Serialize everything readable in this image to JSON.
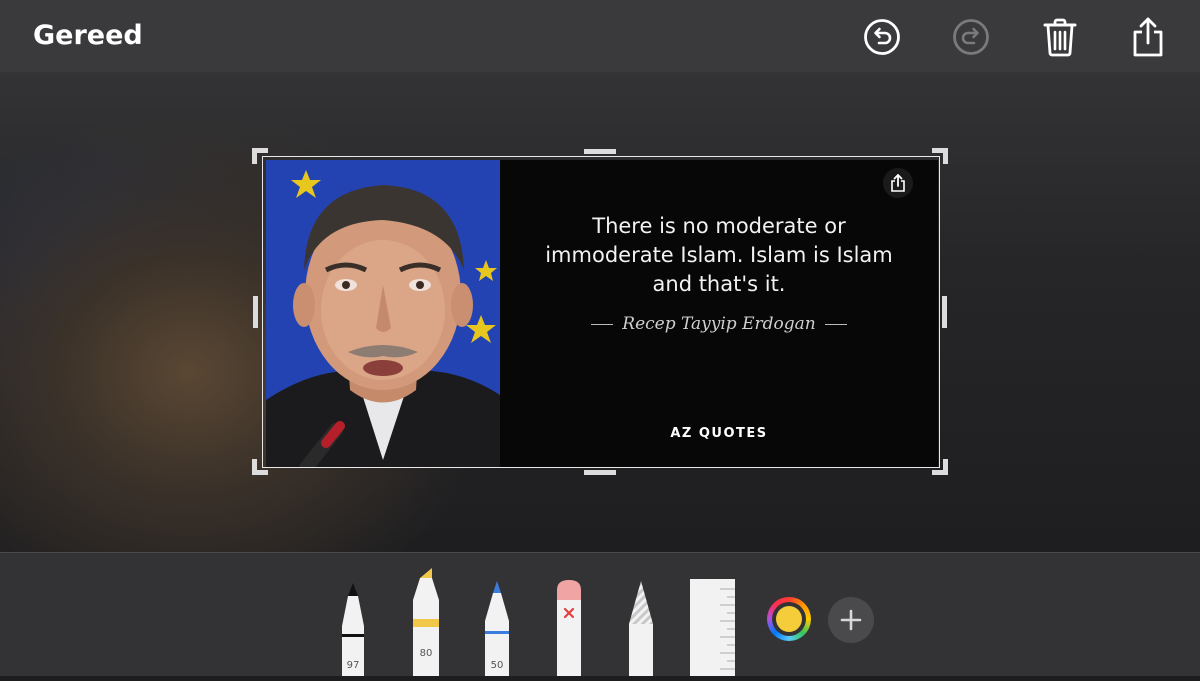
{
  "toolbar_top": {
    "done_label": "Gereed"
  },
  "icons": {
    "undo": "undo-icon",
    "redo": "redo-icon",
    "trash": "trash-icon",
    "share": "share-icon"
  },
  "image": {
    "quote": "There is no moderate or immoderate Islam. Islam is Islam and that's it.",
    "author": "Recep Tayyip Erdogan",
    "brand": "AZ QUOTES"
  },
  "tools": [
    {
      "name": "pen",
      "number": "97"
    },
    {
      "name": "marker",
      "number": "80"
    },
    {
      "name": "pencil",
      "number": "50"
    },
    {
      "name": "eraser"
    },
    {
      "name": "lasso"
    },
    {
      "name": "ruler"
    }
  ],
  "colors": {
    "selected": "#f5cc3a",
    "marker_band": "#f2c84b",
    "pencil_tip": "#3b7ddd"
  }
}
